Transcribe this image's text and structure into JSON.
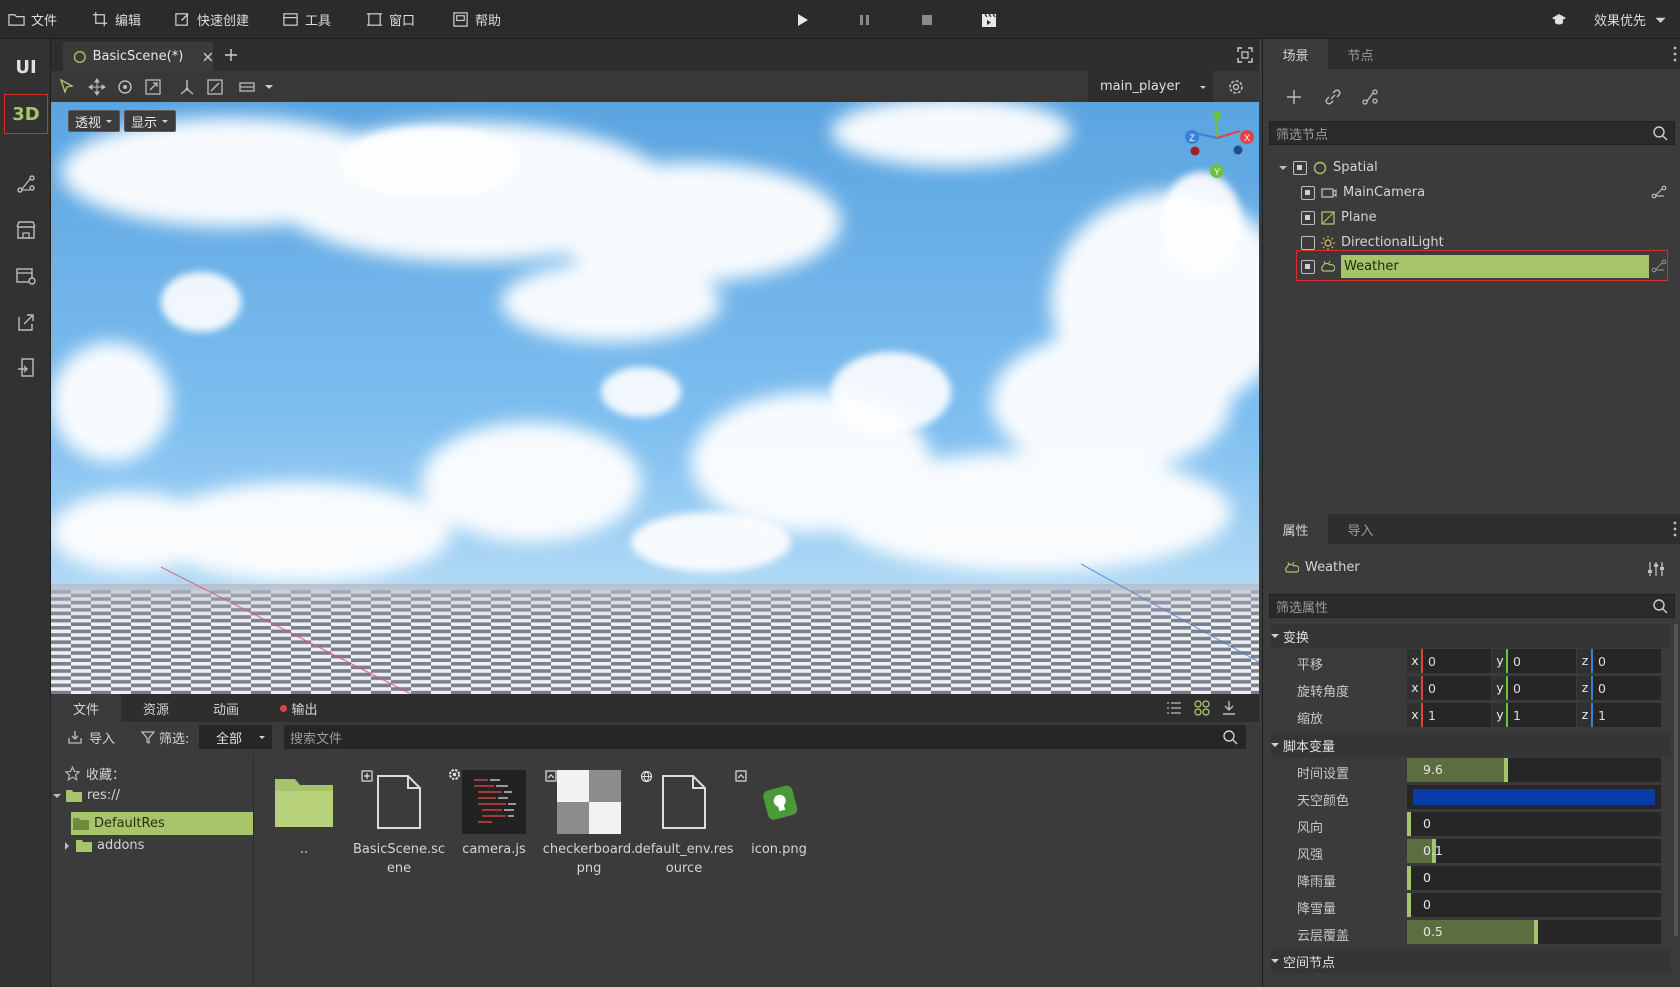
{
  "menu": {
    "file": "文件",
    "edit": "编辑",
    "quick_create": "快速创建",
    "tools": "工具",
    "window": "窗口",
    "help": "帮助",
    "quality": "效果优先"
  },
  "rail": {
    "ui": "UI",
    "three_d": "3D"
  },
  "scene_tab": {
    "title": "BasicScene(*)"
  },
  "viewport": {
    "camera_select": "main_player",
    "perspective": "透视",
    "display": "显示",
    "gizmo": {
      "x": "X",
      "y": "Y",
      "z": "Z"
    }
  },
  "file_panel": {
    "tabs": [
      "文件",
      "资源",
      "动画",
      "输出"
    ],
    "import_label": "导入",
    "filter_label": "筛选:",
    "filter_value": "全部",
    "search_placeholder": "搜索文件",
    "favorites": "收藏：",
    "tree": {
      "root": "res://",
      "default_res": "DefaultRes",
      "addons": "addons"
    },
    "files": [
      {
        "name": "..",
        "icon": "folder-icon"
      },
      {
        "name": "BasicScene.scene",
        "icon": "scene-file-icon"
      },
      {
        "name": "camera.js",
        "icon": "script-file-icon"
      },
      {
        "name": "checkerboard.png",
        "icon": "image-file-icon"
      },
      {
        "name": "default_env.resource",
        "icon": "resource-file-icon"
      },
      {
        "name": "icon.png",
        "icon": "image-file-icon"
      }
    ]
  },
  "scene_panel": {
    "tabs": [
      "场景",
      "节点"
    ],
    "filter_placeholder": "筛选节点",
    "nodes": {
      "spatial": "Spatial",
      "main_camera": "MainCamera",
      "plane": "Plane",
      "light": "DirectionalLight",
      "weather": "Weather"
    }
  },
  "inspector": {
    "tabs": [
      "属性",
      "导入"
    ],
    "node_name": "Weather",
    "filter_placeholder": "筛选属性",
    "transform": {
      "header": "变换",
      "rows": [
        {
          "label": "平移",
          "x": "0",
          "y": "0",
          "z": "0"
        },
        {
          "label": "旋转角度",
          "x": "0",
          "y": "0",
          "z": "0"
        },
        {
          "label": "缩放",
          "x": "1",
          "y": "1",
          "z": "1"
        }
      ]
    },
    "script_vars": {
      "header": "脚本变量",
      "time": {
        "label": "时间设置",
        "value": "9.6",
        "fraction": 0.38
      },
      "sky_color": {
        "label": "天空颜色",
        "color": "#0a3aa8"
      },
      "wind_dir": {
        "label": "风向",
        "value": "0",
        "fraction": 0.0
      },
      "wind_strength": {
        "label": "风强",
        "value": "0.1",
        "fraction": 0.1
      },
      "rain": {
        "label": "降雨量",
        "value": "0",
        "fraction": 0.0
      },
      "snow": {
        "label": "降雪量",
        "value": "0",
        "fraction": 0.0
      },
      "cloud": {
        "label": "云层覆盖",
        "value": "0.5",
        "fraction": 0.5
      }
    },
    "spatial_section": "空间节点"
  },
  "colors": {
    "accent": "#a8c46a",
    "highlight_box": "#d32f2f",
    "x_axis": "#e14343",
    "y_axis": "#6ec23a",
    "z_axis": "#3c7fd6"
  }
}
